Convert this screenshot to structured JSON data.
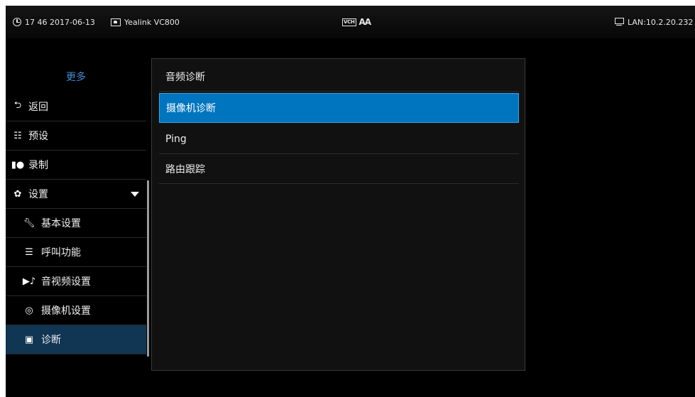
{
  "status_bar": {
    "datetime": "17 46 2017-06-13",
    "device_name": "Yealink VC800",
    "center_icons": [
      "vch-icon",
      "font-size-icon"
    ],
    "vch_text": "VCH",
    "aa_text": "AA",
    "network": "LAN:10.2.20.232"
  },
  "sidebar": {
    "title": "更多",
    "items": [
      {
        "label": "返回",
        "icon": "back-arrow-icon"
      },
      {
        "label": "预设",
        "icon": "preset-icon"
      },
      {
        "label": "录制",
        "icon": "record-icon"
      },
      {
        "label": "设置",
        "icon": "gear-icon",
        "expanded": true
      },
      {
        "label": "基本设置",
        "icon": "wrench-icon"
      },
      {
        "label": "呼叫功能",
        "icon": "call-feature-icon"
      },
      {
        "label": "音视频设置",
        "icon": "audio-video-icon"
      },
      {
        "label": "摄像机设置",
        "icon": "camera-settings-icon"
      },
      {
        "label": "诊断",
        "icon": "diagnostic-icon",
        "active": true
      }
    ]
  },
  "diagnostics": {
    "options": [
      {
        "label": "音频诊断"
      },
      {
        "label": "摄像机诊断",
        "selected": true
      },
      {
        "label": "Ping"
      },
      {
        "label": "路由跟踪"
      }
    ]
  },
  "colors": {
    "background": "#000000",
    "accent_title": "#3d8fd6",
    "selected_option": "#0075bf",
    "active_menu": "#113654"
  }
}
